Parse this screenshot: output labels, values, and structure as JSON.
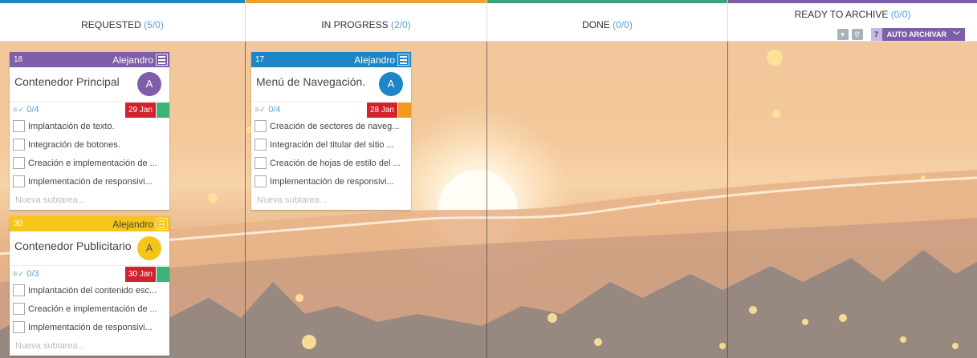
{
  "columns": [
    {
      "label": "REQUESTED",
      "count": "(5/0)",
      "color": "#1f86c5"
    },
    {
      "label": "IN PROGRESS",
      "count": "(2/0)",
      "color": "#f0a030"
    },
    {
      "label": "DONE",
      "count": "(0/0)",
      "color": "#3aa57a"
    },
    {
      "label": "READY TO ARCHIVE",
      "count": "(0/0)",
      "color": "#7e5ea9"
    }
  ],
  "archive": {
    "auto_count": "7",
    "auto_label": "AUTO ARCHIVAR",
    "icons": [
      "archive-icon",
      "search-icon"
    ]
  },
  "cards": [
    {
      "id": "18",
      "owner": "Alejandro",
      "title": "Contenedor Principal",
      "avatar": "A",
      "color": "#7e5ea9",
      "subtasks": "0/4",
      "date": "29 Jan",
      "date_color": "#d0232e",
      "priority_color": "#3db37a",
      "tasks": [
        "Implantación de texto.",
        "Integración de botones.",
        "Creación e implementación de ...",
        "Implementación de responsivi..."
      ],
      "new_placeholder": "Nueva subtarea..."
    },
    {
      "id": "30",
      "owner": "Alejandro",
      "title": "Contenedor Publicitario",
      "avatar": "A",
      "color": "#f5c518",
      "subtasks": "0/3",
      "date": "30 Jan",
      "date_color": "#d0232e",
      "priority_color": "#3db37a",
      "tasks": [
        "Implantación del contenido esc...",
        "Creación e implementación de ...",
        "Implementación de responsivi..."
      ],
      "new_placeholder": "Nueva subtarea..."
    },
    {
      "id": "17",
      "owner": "Alejandro",
      "title": "Menú de Navegación.",
      "avatar": "A",
      "color": "#1f86c5",
      "subtasks": "0/4",
      "date": "28 Jan",
      "date_color": "#d0232e",
      "priority_color": "#f39a1e",
      "tasks": [
        "Creación de sectores de naveg...",
        "Integración del titular del sitio ...",
        "Creación de hojas de estilo del ...",
        "Implementación de responsivi..."
      ],
      "new_placeholder": "Nueva subtarea..."
    }
  ]
}
